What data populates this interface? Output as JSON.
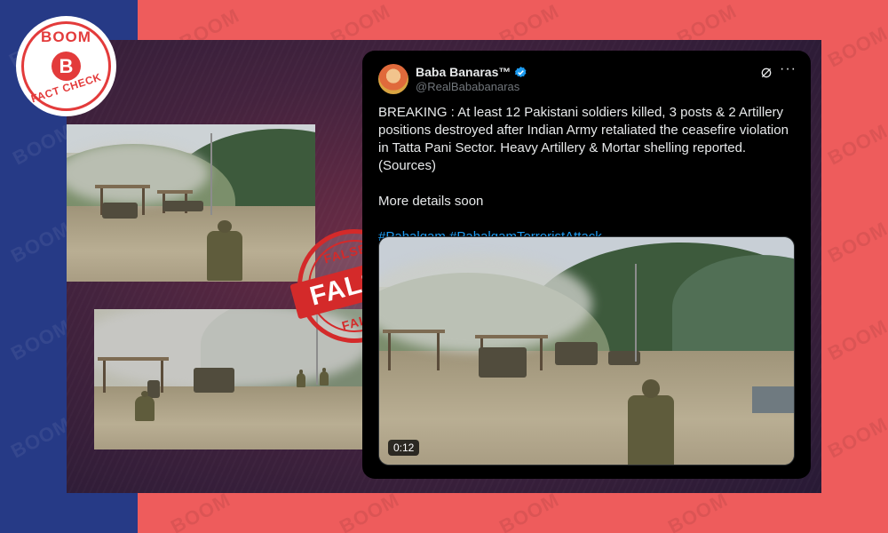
{
  "brand": {
    "logo_top": "BOOM",
    "logo_mark": "B",
    "logo_bottom": "FACT CHECK",
    "watermark": "BOOM",
    "colors": {
      "red": "#ee5c5c",
      "navy": "#263a86",
      "stamp": "#d42a2a"
    }
  },
  "stamp": {
    "top": "FALSE",
    "center": "FALSE",
    "bottom": "FALSE"
  },
  "tweet": {
    "display_name": "Baba Banaras™",
    "handle": "@RealBababanaras",
    "icons": [
      "verified-icon",
      "grok-icon",
      "more-icon"
    ],
    "body": "BREAKING : At least 12 Pakistani soldiers killed, 3 posts & 2 Artillery positions destroyed after Indian Army retaliated the ceasefire violation in Tatta Pani Sector. Heavy Artillery & Mortar shelling reported.(Sources)",
    "more": "More details soon",
    "hashtags": "#Pahalgam #PahalgamTerroristAttack",
    "video_duration": "0:12"
  }
}
